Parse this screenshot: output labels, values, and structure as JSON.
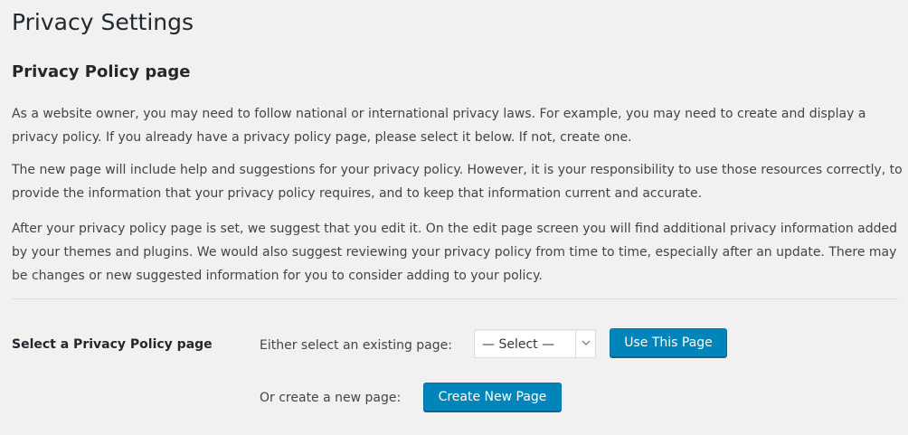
{
  "page": {
    "title": "Privacy Settings"
  },
  "section": {
    "title": "Privacy Policy page",
    "paragraphs": [
      "As a website owner, you may need to follow national or international privacy laws. For example, you may need to create and display a privacy policy. If you already have a privacy policy page, please select it below. If not, create one.",
      "The new page will include help and suggestions for your privacy policy. However, it is your responsibility to use those resources correctly, to provide the information that your privacy policy requires, and to keep that information current and accurate.",
      "After your privacy policy page is set, we suggest that you edit it. On the edit page screen you will find additional privacy information added by your themes and plugins. We would also suggest reviewing your privacy policy from time to time, especially after an update. There may be changes or new suggested information for you to consider adding to your policy."
    ]
  },
  "form": {
    "row_label": "Select a Privacy Policy page",
    "existing_label": "Either select an existing page:",
    "select_value": "— Select —",
    "use_button": "Use This Page",
    "create_label": "Or create a new page:",
    "create_button": "Create New Page"
  },
  "colors": {
    "background": "#f1f1f1",
    "button_primary": "#0085ba",
    "text": "#444444"
  }
}
